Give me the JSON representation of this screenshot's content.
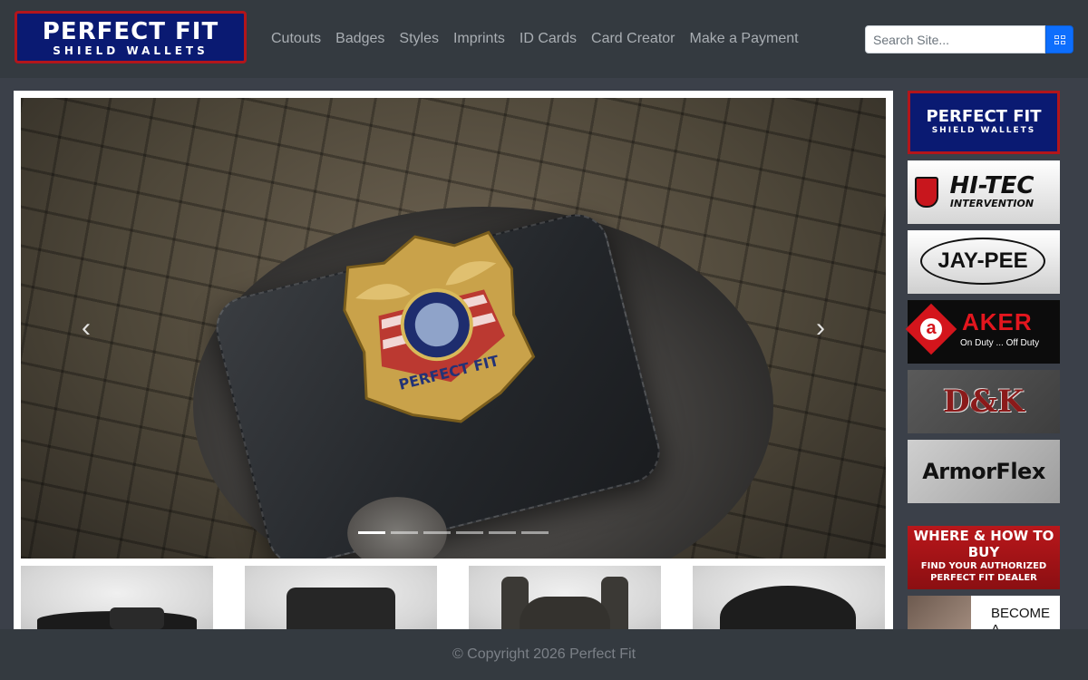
{
  "header": {
    "logo": {
      "line1": "PERFECT FIT",
      "line2": "SHIELD WALLETS"
    },
    "nav": [
      {
        "label": "Cutouts"
      },
      {
        "label": "Badges"
      },
      {
        "label": "Styles"
      },
      {
        "label": "Imprints"
      },
      {
        "label": "ID Cards"
      },
      {
        "label": "Card Creator"
      },
      {
        "label": "Make a Payment"
      }
    ],
    "search": {
      "placeholder": "Search Site...",
      "button_icon": "grid-icon"
    }
  },
  "carousel": {
    "prev_icon": "chevron-left-icon",
    "next_icon": "chevron-right-icon",
    "prev_glyph": "‹",
    "next_glyph": "›",
    "slide_count": 6,
    "active_slide": 1,
    "badge_text": "PERFECT FIT"
  },
  "sidebar": {
    "perfect_fit": {
      "line1": "PERFECT FIT",
      "line2": "SHIELD WALLETS"
    },
    "hitec": {
      "line1": "HI-TEC",
      "line2": "INTERVENTION"
    },
    "jaypee": {
      "label": "JAY-PEE"
    },
    "aker": {
      "mark": "a",
      "name": "AKER",
      "tagline": "On Duty ... Off Duty"
    },
    "dk": {
      "label": "D&K"
    },
    "armorflex": {
      "label": "ArmorFlex"
    },
    "where_to_buy": {
      "line1": "WHERE & HOW TO BUY",
      "line2": "FIND YOUR AUTHORIZED",
      "line3": "PERFECT FIT DEALER"
    },
    "become": {
      "label": "BECOME A"
    }
  },
  "footer": {
    "copyright": "© Copyright 2026 Perfect Fit"
  },
  "colors": {
    "header_bg": "#343a40",
    "brand_blue": "#0a1a72",
    "brand_red": "#b3151b",
    "search_button": "#0d6efd"
  }
}
